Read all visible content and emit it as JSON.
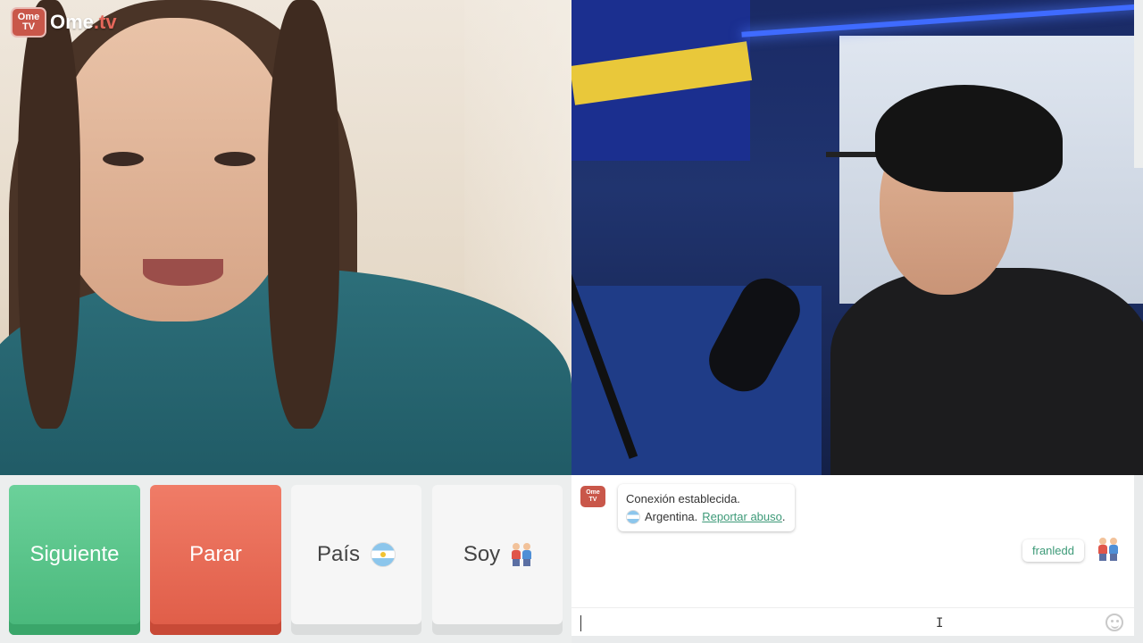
{
  "app": {
    "logo_text_main": "Ome",
    "logo_text_suffix": ".tv",
    "logo_tv_line1": "Ome",
    "logo_tv_line2": "TV"
  },
  "controls": {
    "next_label": "Siguiente",
    "stop_label": "Parar",
    "country_label": "País",
    "gender_label": "Soy"
  },
  "chat": {
    "system_line1": "Conexión establecida.",
    "system_country": "Argentina.",
    "report_abuse": "Reportar abuso",
    "report_suffix": ".",
    "user_name": "franledd",
    "avatar_line1": "Ome",
    "avatar_line2": "TV"
  },
  "colors": {
    "next": "#4fbf80",
    "stop": "#e4644f",
    "link": "#3d9a78",
    "brand": "#c9574a"
  }
}
